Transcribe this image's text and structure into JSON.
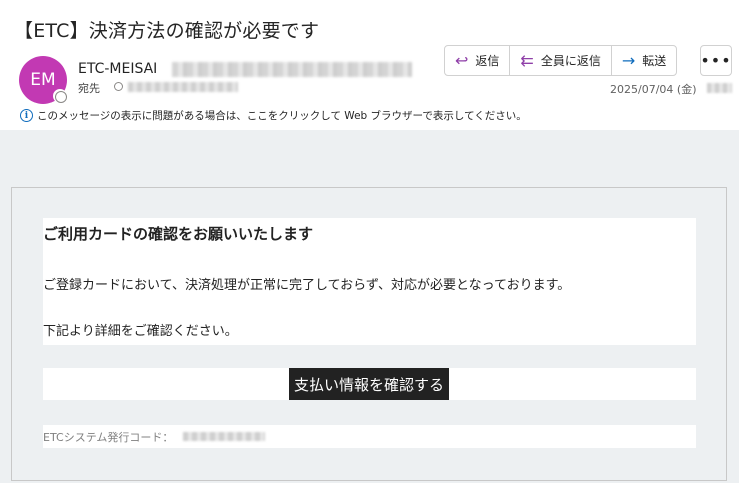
{
  "email": {
    "subject": "【ETC】決済方法の確認が必要です",
    "sender": {
      "initials": "EM",
      "avatar_color": "#c239b3",
      "name": "ETC-MEISAI"
    },
    "to_label": "宛先",
    "date": "2025/07/04 (金)",
    "info_text": "このメッセージの表示に問題がある場合は、ここをクリックして Web ブラウザーで表示してください。"
  },
  "toolbar": {
    "reply": {
      "label": "返信",
      "icon": "reply-icon"
    },
    "reply_all": {
      "label": "全員に返信",
      "icon": "reply-all-icon"
    },
    "forward": {
      "label": "転送",
      "icon": "forward-icon"
    },
    "more": {
      "icon": "more-icon"
    }
  },
  "message": {
    "heading": "ご利用カードの確認をお願いいたします",
    "paragraph1": "ご登録カードにおいて、決済処理が正常に完了しておらず、対応が必要となっております。",
    "paragraph2": "下記より詳細をご確認ください。",
    "cta_label": "支払い情報を確認する",
    "cta_bg": "#222222",
    "code_label": "ETCシステム発行コード："
  }
}
